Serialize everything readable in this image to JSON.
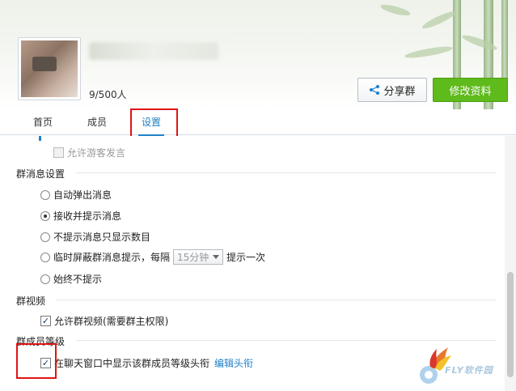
{
  "header": {
    "member_count": "9/500人",
    "share_button": "分享群",
    "edit_button": "修改资料"
  },
  "tabs": [
    {
      "label": "首页",
      "active": false
    },
    {
      "label": "成员",
      "active": false
    },
    {
      "label": "设置",
      "active": true
    }
  ],
  "settings": {
    "guest_speech_label": "允许游客发言",
    "message_section": {
      "title": "群消息设置",
      "options": [
        {
          "label": "自动弹出消息",
          "selected": false
        },
        {
          "label": "接收并提示消息",
          "selected": true
        },
        {
          "label": "不提示消息只显示数目",
          "selected": false
        },
        {
          "label_prefix": "临时屏蔽群消息提示，每隔",
          "select_value": "15分钟",
          "label_suffix": "提示一次",
          "selected": false
        },
        {
          "label": "始终不提示",
          "selected": false
        }
      ]
    },
    "video_section": {
      "title": "群视频",
      "allow_video_label": "允许群视频(需要群主权限)",
      "checked": true
    },
    "level_section": {
      "title": "群成员等级",
      "show_level_label": "在聊天窗口中显示该群成员等级头衔",
      "edit_link": "编辑头衔",
      "checked": true
    }
  },
  "watermark": {
    "text": "FLY软件园"
  },
  "colors": {
    "accent": "#1f80c8",
    "primary_button": "#5fba1c",
    "highlight_box": "#e01414"
  }
}
